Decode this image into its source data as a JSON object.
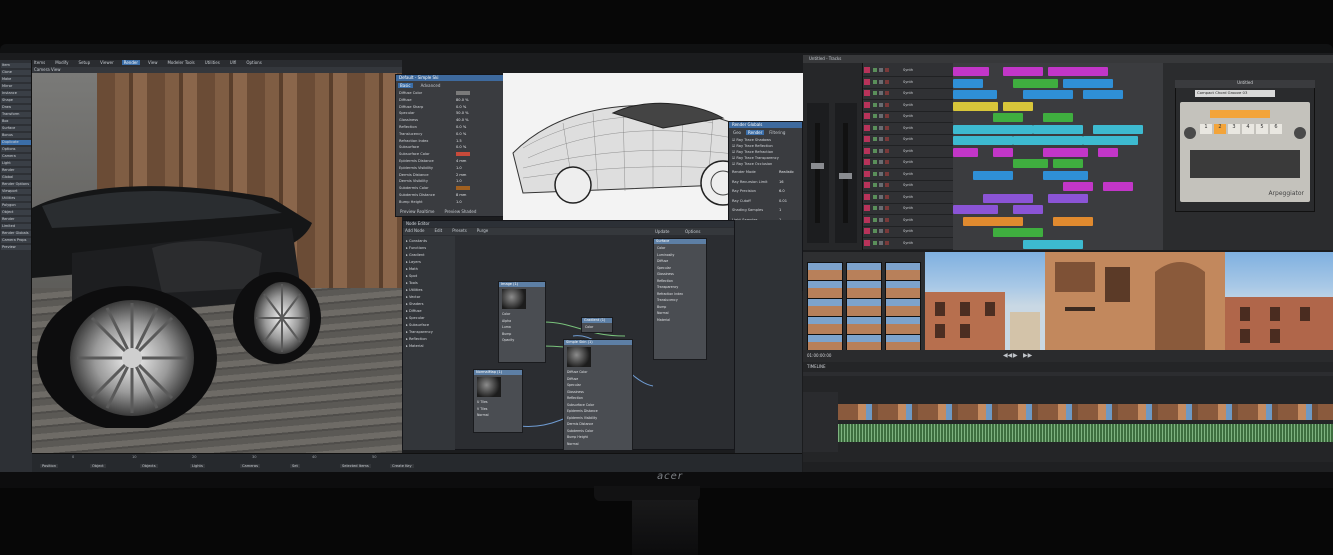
{
  "monitor": {
    "brand": "acer"
  },
  "left_app": {
    "menu_tabs": [
      "Items",
      "Modify",
      "Setup",
      "Viewer",
      "Render",
      "View",
      "Modeler Tools",
      "Utilities",
      "Ulfi",
      "Options"
    ],
    "active_tab": "Render",
    "view_label": "Camera View",
    "sidebar_items": [
      "Item",
      "Clone",
      "Make",
      "Mirror",
      "Instance",
      "Shape",
      "Draw",
      "Transform",
      "Box",
      "Surface",
      "Bonus",
      "Duplicate",
      "Options",
      "Camera",
      "Light",
      "Render",
      "Global",
      "Render Options",
      "Viewport",
      "Utilities",
      "Polygon",
      "Object",
      "Render",
      "Limited",
      "Render Globals",
      "Camera Props",
      "Preview"
    ],
    "bottom_fields": [
      "Position",
      "Object",
      "Objects",
      "Lights",
      "Cameras",
      "Set",
      "Selected Items",
      "Create Key"
    ],
    "bottom_numbers": [
      "0",
      "10",
      "20",
      "30",
      "40",
      "50"
    ]
  },
  "surface_editor": {
    "title": "Default - Simple Ski",
    "tabs": [
      "Basic",
      "Advanced"
    ],
    "rows": [
      {
        "label": "Diffuse Color",
        "value": "",
        "swatch": "#7a7a7a"
      },
      {
        "label": "Diffuse",
        "value": "80.0 %"
      },
      {
        "label": "Diffuse Sharp",
        "value": "0.0 %"
      },
      {
        "label": "Specular",
        "value": "50.0 %"
      },
      {
        "label": "Glossiness",
        "value": "40.0 %"
      },
      {
        "label": "Reflection",
        "value": "0.0 %"
      },
      {
        "label": "Translucency",
        "value": "0.0 %"
      },
      {
        "label": "Refraction Index",
        "value": "1.5"
      },
      {
        "label": "Subsurface",
        "value": "0.0 %"
      },
      {
        "label": "Subsurface Color",
        "value": "",
        "swatch": "#c84a3a"
      },
      {
        "label": "Epidermis Distance",
        "value": "4 mm"
      },
      {
        "label": "Epidermis Visibility",
        "value": "1.0"
      },
      {
        "label": "Dermis Distance",
        "value": "2 mm"
      },
      {
        "label": "Dermis Visibility",
        "value": "1.0"
      },
      {
        "label": "Subdermis Color",
        "value": "",
        "swatch": "#a06020"
      },
      {
        "label": "Subdermis Distance",
        "value": "8 mm"
      },
      {
        "label": "Bump Height",
        "value": "1.0"
      }
    ],
    "footer": [
      "Preview Realtime",
      "Preview Shaded"
    ]
  },
  "render_settings": {
    "title": "Render Globals",
    "tabs": [
      "Geo",
      "Render",
      "Filtering"
    ],
    "checks": [
      "Ray Trace Shadows",
      "Ray Trace Reflection",
      "Ray Trace Refraction",
      "Ray Trace Transparency",
      "Ray Trace Occlusion"
    ],
    "fields": [
      {
        "label": "Render Mode",
        "value": "Realistic"
      },
      {
        "label": "Ray Recursion Limit",
        "value": "16"
      },
      {
        "label": "Ray Precision",
        "value": "6.0"
      },
      {
        "label": "Ray Cutoff",
        "value": "0.01"
      },
      {
        "label": "Shading Samples",
        "value": "1"
      },
      {
        "label": "Light Samples",
        "value": "1"
      },
      {
        "label": "Light Intensity",
        "value": "100.0 %"
      },
      {
        "label": "Fog Intensity",
        "value": "100.0 %"
      },
      {
        "label": "Lens Flares",
        "value": ""
      },
      {
        "label": "Motion Blur",
        "value": "Off"
      },
      {
        "label": "HDR Filtering",
        "value": "None"
      },
      {
        "label": "Multithreading",
        "value": "Automatic"
      }
    ]
  },
  "node_editor": {
    "title": "Node Editor",
    "menu": [
      "Add Node",
      "Edit",
      "Presets",
      "Purge"
    ],
    "toolbar_right": [
      "Update",
      "Options"
    ],
    "node_categories": [
      "Constants",
      "Functions",
      "Gradient",
      "Layers",
      "Math",
      "Spot",
      "Tools",
      "Utilities",
      "Vector",
      "Shaders",
      "Diffuse",
      "Specular",
      "Subsurface",
      "Transparency",
      "Reflection",
      "Material"
    ],
    "nodes": [
      {
        "title": "Image (1)",
        "ports": [
          "Color",
          "Alpha",
          "Luma",
          "Bump",
          "Opacity"
        ]
      },
      {
        "title": "Gradient (1)",
        "ports": [
          "Color",
          "Alpha"
        ]
      },
      {
        "title": "Simple Skin (1)",
        "ports": [
          "Diffuse Color",
          "Diffuse",
          "Specular",
          "Glossiness",
          "Reflection",
          "Subsurface Color",
          "Epidermis Distance",
          "Epidermis Visibility",
          "Dermis Distance",
          "Subdermis Color",
          "Bump Height",
          "Normal"
        ]
      },
      {
        "title": "Surface",
        "ports": [
          "Color",
          "Luminosity",
          "Diffuse",
          "Specular",
          "Glossiness",
          "Reflection",
          "Transparency",
          "Refraction Index",
          "Translucency",
          "Bump",
          "Normal",
          "Material"
        ]
      },
      {
        "title": "NormalMap (1)",
        "ports": [
          "U Tiles",
          "V Tiles",
          "Normal"
        ]
      }
    ]
  },
  "daw": {
    "title": "Untitled - Tracks",
    "tracks": [
      {
        "name": "Synth",
        "color": "#b8335a"
      },
      {
        "name": "Synth",
        "color": "#b8335a"
      },
      {
        "name": "Synth",
        "color": "#b8335a"
      },
      {
        "name": "Synth",
        "color": "#b8335a"
      },
      {
        "name": "Synth",
        "color": "#b8335a"
      },
      {
        "name": "Synth",
        "color": "#b8335a"
      },
      {
        "name": "Synth",
        "color": "#b8335a"
      },
      {
        "name": "Synth",
        "color": "#b8335a"
      },
      {
        "name": "Synth",
        "color": "#b8335a"
      },
      {
        "name": "Synth",
        "color": "#b8335a"
      },
      {
        "name": "Synth",
        "color": "#b8335a"
      },
      {
        "name": "Synth",
        "color": "#b8335a"
      },
      {
        "name": "Synth",
        "color": "#b8335a"
      },
      {
        "name": "Synth",
        "color": "#b8335a"
      },
      {
        "name": "Synth",
        "color": "#b8335a"
      },
      {
        "name": "Synth",
        "color": "#b8335a"
      }
    ],
    "plugin": {
      "title": "Untitled",
      "preset": "Compact Chord Groove 03",
      "name": "Arpeggiator",
      "buttons": [
        "1",
        "2",
        "3",
        "4",
        "5",
        "6"
      ]
    },
    "region_colors": [
      "#3fae3f",
      "#c236c8",
      "#2f8fd6",
      "#3dbad0",
      "#d8c63a",
      "#e08a2f",
      "#8b54d6"
    ]
  },
  "video_editor": {
    "timeline_label": "TIMELINE",
    "timecode": "01:00:00:00"
  }
}
